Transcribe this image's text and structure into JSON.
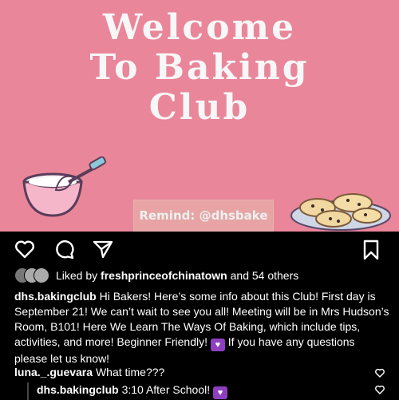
{
  "colors": {
    "background": "#e9869a",
    "remind_bg": "#e8a4a4"
  },
  "post_image": {
    "title_lines": [
      "Welcome",
      "To Baking",
      "Club"
    ],
    "remind_text": "Remind: @dhsbake",
    "illustrations": [
      "whisk-bowl-icon",
      "cookie-plate-icon"
    ]
  },
  "action_bar": {
    "icons": [
      "heart-icon",
      "comment-icon",
      "share-icon",
      "bookmark-icon"
    ]
  },
  "likes": {
    "prefix": "Liked by",
    "user": "freshprinceofchinatown",
    "suffix": "and 54 others"
  },
  "caption": {
    "user": "dhs.bakingclub",
    "text1": "Hi Bakers! Here’s some info about this Club! First day is September 21! We can’t wait to see you all! Meeting will be in Mrs Hudson’s Room, B101! Here We Learn The Ways Of Baking, which include tips, activities, and more! Beginner Friendly!",
    "text2": "If you have any questions please let us know!"
  },
  "comments": [
    {
      "user": "luna._.guevara",
      "text": "What time???"
    },
    {
      "user": "dhs.bakingclub",
      "text": "3:10 After School!"
    }
  ]
}
